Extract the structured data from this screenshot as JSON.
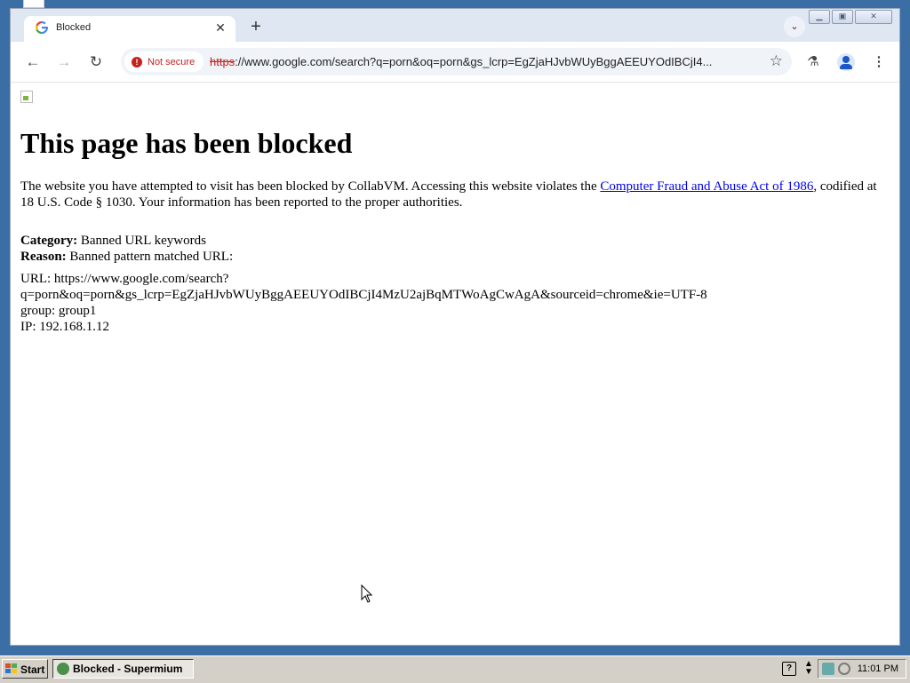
{
  "browser": {
    "tab": {
      "title": "Blocked"
    },
    "security_chip": "Not secure",
    "url": {
      "scheme": "https",
      "rest": "://www.google.com/search?q=porn&oq=porn&gs_lcrp=EgZjaHJvbWUyBggAEEUYOdIBCjI4..."
    }
  },
  "page": {
    "heading": "This page has been blocked",
    "intro_before_link": "The website you have attempted to visit has been blocked by CollabVM. Accessing this website violates the ",
    "link_text": "Computer Fraud and Abuse Act of 1986",
    "intro_after_link": ", codified at 18 U.S. Code § 1030. Your information has been reported to the proper authorities.",
    "category_label": "Category:",
    "category_value": " Banned URL keywords",
    "reason_label": "Reason:",
    "reason_value": " Banned pattern matched URL:",
    "details": "URL: https://www.google.com/search?\nq=porn&oq=porn&gs_lcrp=EgZjaHJvbWUyBggAEEUYOdIBCjI4MzU2ajBqMTWoAgCwAgA&sourceid=chrome&ie=UTF-8\ngroup: group1\nIP: 192.168.1.12"
  },
  "taskbar": {
    "start_label": "Start",
    "task_label": "Blocked - Supermium",
    "clock": "11:01 PM",
    "help_glyph": "?"
  }
}
